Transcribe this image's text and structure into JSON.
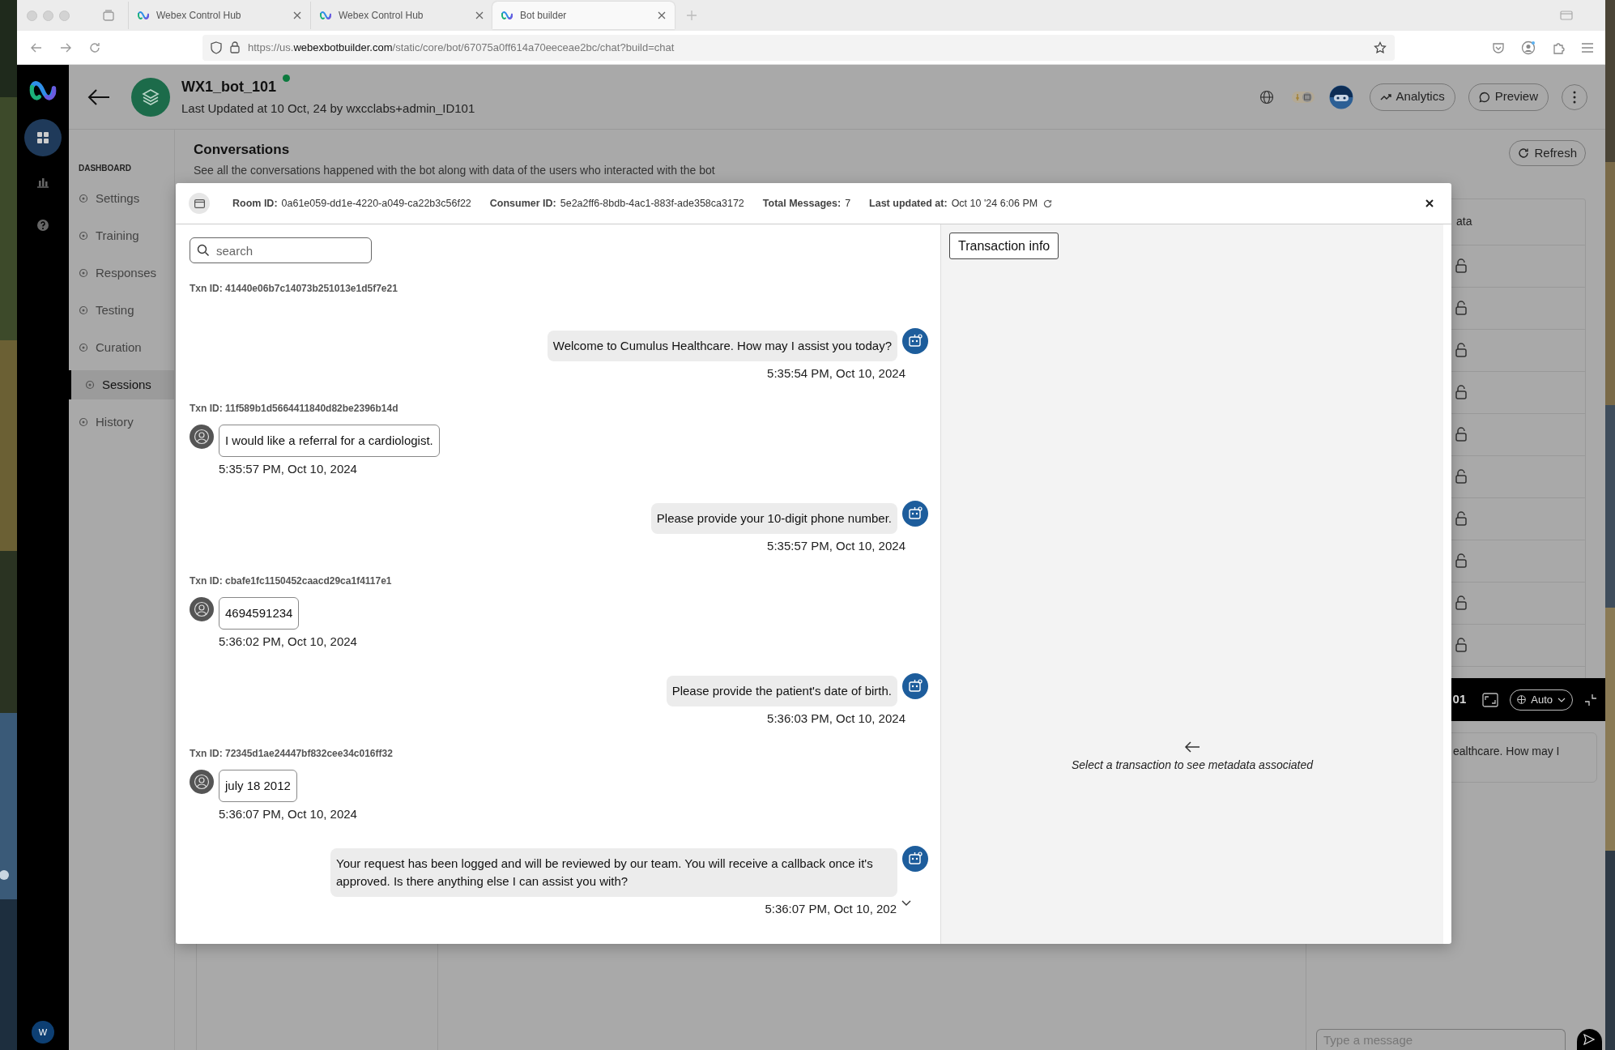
{
  "browser": {
    "tabs": [
      {
        "title": "Webex Control Hub",
        "selected": false
      },
      {
        "title": "Webex Control Hub",
        "selected": false
      },
      {
        "title": "Bot builder",
        "selected": true
      }
    ],
    "url": {
      "scheme": "https://us.",
      "domain": "webexbotbuilder.com",
      "path": "/static/core/bot/67075a0ff614a70eeceae2bc/chat?build=chat"
    }
  },
  "rail": {
    "items": [
      {
        "kind": "dashboard",
        "selected": true
      },
      {
        "kind": "chart",
        "selected": false
      },
      {
        "kind": "help",
        "selected": false
      }
    ],
    "user_initial": "W"
  },
  "bot": {
    "name": "WX1_bot_101",
    "online": true,
    "updated": "Last Updated at 10 Oct, 24 by wxcclabs+admin_ID101"
  },
  "header_buttons": [
    {
      "kind": "analytics",
      "label": "Analytics"
    },
    {
      "kind": "preview",
      "label": "Preview"
    }
  ],
  "sidebar": {
    "heading": "DASHBOARD",
    "items": [
      {
        "label": "Settings",
        "selected": false
      },
      {
        "label": "Training",
        "selected": false
      },
      {
        "label": "Responses",
        "selected": false
      },
      {
        "label": "Testing",
        "selected": false
      },
      {
        "label": "Curation",
        "selected": false
      },
      {
        "label": "Sessions",
        "selected": true
      },
      {
        "label": "History",
        "selected": false
      }
    ]
  },
  "page": {
    "title": "Conversations",
    "subtitle": "See all the conversations happened with the bot along with data of the users who interacted with the bot",
    "refresh": "Refresh",
    "column_header": "ata"
  },
  "chat_widget": {
    "title": "01",
    "language": "Auto",
    "message": "ealthcare. How may I",
    "placeholder": "Type a message"
  },
  "modal": {
    "fields": [
      {
        "label": "Room ID:",
        "value": "0a61e059-dd1e-4220-a049-ca22b3c56f22"
      },
      {
        "label": "Consumer ID:",
        "value": "5e2a2ff6-8bdb-4ac1-883f-ade358ca3172"
      },
      {
        "label": "Total Messages:",
        "value": "7"
      },
      {
        "label": "Last updated at:",
        "value": "Oct 10 '24 6:06 PM"
      }
    ],
    "search": {
      "placeholder": "search"
    },
    "transactions": [
      {
        "txn_id": "Txn ID: 41440e06b7c14073b251013e1d5f7e21",
        "messages": [
          {
            "kind": "bot",
            "text": "Welcome to Cumulus Healthcare. How may I assist you today?",
            "time": "5:35:54 PM, Oct 10, 2024"
          }
        ]
      },
      {
        "txn_id": "Txn ID: 11f589b1d5664411840d82be2396b14d",
        "messages": [
          {
            "kind": "user",
            "text": "I would like a referral for a cardiologist.",
            "time": "5:35:57 PM, Oct 10, 2024"
          },
          {
            "kind": "bot",
            "text": "Please provide your 10-digit phone number.",
            "time": "5:35:57 PM, Oct 10, 2024"
          }
        ]
      },
      {
        "txn_id": "Txn ID: cbafe1fc1150452caacd29ca1f4117e1",
        "messages": [
          {
            "kind": "user",
            "text": "4694591234",
            "time": "5:36:02 PM, Oct 10, 2024"
          },
          {
            "kind": "bot",
            "text": "Please provide the patient's date of birth.",
            "time": "5:36:03 PM, Oct 10, 2024"
          }
        ]
      },
      {
        "txn_id": "Txn ID: 72345d1ae24447bf832cee34c016ff32",
        "messages": [
          {
            "kind": "user",
            "text": "july 18 2012",
            "time": "5:36:07 PM, Oct 10, 2024"
          },
          {
            "kind": "bot",
            "text": "Your request has been logged and will be reviewed by our team. You will receive a callback once it's approved. Is there anything else I can assist you with?",
            "time": "5:36:07 PM, Oct 10, 202"
          }
        ]
      }
    ],
    "info_button": "Transaction info",
    "hint": "Select a transaction to see metadata associated"
  }
}
